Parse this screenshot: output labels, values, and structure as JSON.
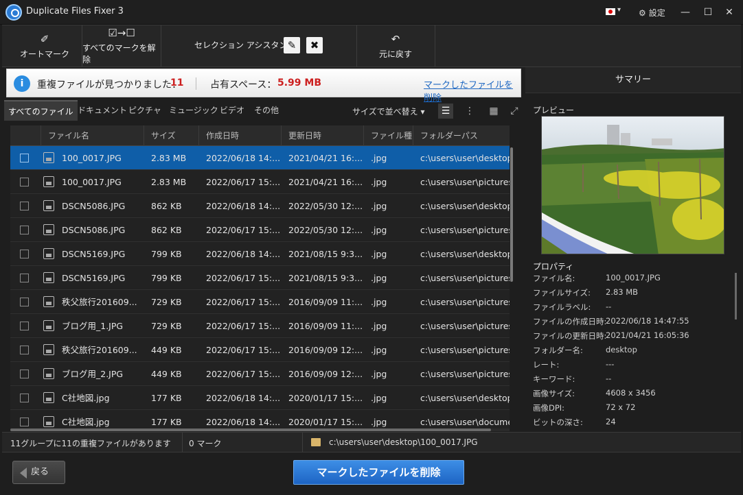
{
  "window": {
    "title": "Duplicate Files Fixer 3",
    "settings_label": "設定",
    "lang_caret": "▾"
  },
  "toolbar": {
    "auto_mark": "オートマーク",
    "unmark_all": "すべてのマークを解除",
    "selection_assistant": "セレクション アシスタント",
    "undo": "元に戻す"
  },
  "banner": {
    "found_label": "重複ファイルが見つかりました：",
    "found_count": "11",
    "space_label": "占有スペース：",
    "space_value": "5.99 MB",
    "delete_link": "マークしたファイルを削除"
  },
  "summary": {
    "title": "サマリー"
  },
  "tabs": [
    "すべてのファイル",
    "ドキュメント",
    "ピクチャ",
    "ミュージック",
    "ビデオ",
    "その他"
  ],
  "sort_label": "サイズで並べ替え ▾",
  "table": {
    "columns": [
      "ファイル名",
      "サイズ",
      "作成日時",
      "更新日時",
      "ファイル種類",
      "フォルダーパス"
    ],
    "rows": [
      [
        "100_0017.JPG",
        "2.83 MB",
        "2022/06/18 14:...",
        "2021/04/21 16:...",
        ".jpg",
        "c:\\users\\user\\desktop"
      ],
      [
        "100_0017.JPG",
        "2.83 MB",
        "2022/06/17 15:...",
        "2021/04/21 16:...",
        ".jpg",
        "c:\\users\\user\\pictures\\"
      ],
      [
        "DSCN5086.JPG",
        "862 KB",
        "2022/06/18 14:...",
        "2022/05/30 12:...",
        ".jpg",
        "c:\\users\\user\\desktop"
      ],
      [
        "DSCN5086.JPG",
        "862 KB",
        "2022/06/17 15:...",
        "2022/05/30 12:...",
        ".jpg",
        "c:\\users\\user\\pictures\\"
      ],
      [
        "DSCN5169.JPG",
        "799 KB",
        "2022/06/18 14:...",
        "2021/08/15 9:3...",
        ".jpg",
        "c:\\users\\user\\desktop"
      ],
      [
        "DSCN5169.JPG",
        "799 KB",
        "2022/06/17 15:...",
        "2021/08/15 9:3...",
        ".jpg",
        "c:\\users\\user\\pictures\\"
      ],
      [
        "秩父旅行201609...",
        "729 KB",
        "2022/06/17 15:...",
        "2016/09/09 11:...",
        ".jpg",
        "c:\\users\\user\\pictures\\"
      ],
      [
        "ブログ用_1.JPG",
        "729 KB",
        "2022/06/17 15:...",
        "2016/09/09 11:...",
        ".jpg",
        "c:\\users\\user\\pictures\\"
      ],
      [
        "秩父旅行201609...",
        "449 KB",
        "2022/06/17 15:...",
        "2016/09/09 12:...",
        ".jpg",
        "c:\\users\\user\\pictures\\"
      ],
      [
        "ブログ用_2.JPG",
        "449 KB",
        "2022/06/17 15:...",
        "2016/09/09 12:...",
        ".jpg",
        "c:\\users\\user\\pictures\\"
      ],
      [
        "C社地図.jpg",
        "177 KB",
        "2022/06/18 14:...",
        "2020/01/17 15:...",
        ".jpg",
        "c:\\users\\user\\desktop"
      ],
      [
        "C社地図.jpg",
        "177 KB",
        "2022/06/18 14:...",
        "2020/01/17 15:...",
        ".jpg",
        "c:\\users\\user\\docume..."
      ]
    ]
  },
  "preview": {
    "label": "プレビュー",
    "props_title": "プロパティ",
    "props": [
      {
        "key": "ファイル名:",
        "value": "100_0017.JPG"
      },
      {
        "key": "ファイルサイズ:",
        "value": "2.83 MB"
      },
      {
        "key": "ファイルラベル:",
        "value": "--"
      },
      {
        "key": "ファイルの作成日時:",
        "value": "2022/06/18 14:47:55"
      },
      {
        "key": "ファイルの更新日時:",
        "value": "2021/04/21 16:05:36"
      },
      {
        "key": "フォルダー名:",
        "value": "desktop"
      },
      {
        "key": "レート:",
        "value": "---"
      },
      {
        "key": "キーワード:",
        "value": "--"
      },
      {
        "key": "画像サイズ:",
        "value": "4608 x 3456"
      },
      {
        "key": "画像DPI:",
        "value": "72 x 72"
      },
      {
        "key": "ビットの深さ:",
        "value": "24"
      }
    ]
  },
  "status": {
    "groups": "11グループに11の重複ファイルがあります",
    "marks": "0 マーク",
    "path": "c:\\users\\user\\desktop\\100_0017.JPG"
  },
  "buttons": {
    "back": "戻る",
    "delete_marked": "マークしたファイルを削除"
  },
  "colors": {
    "accent": "#1d64c4",
    "selected_row": "#0f5ea8",
    "highlight_red": "#cc1f1f"
  }
}
